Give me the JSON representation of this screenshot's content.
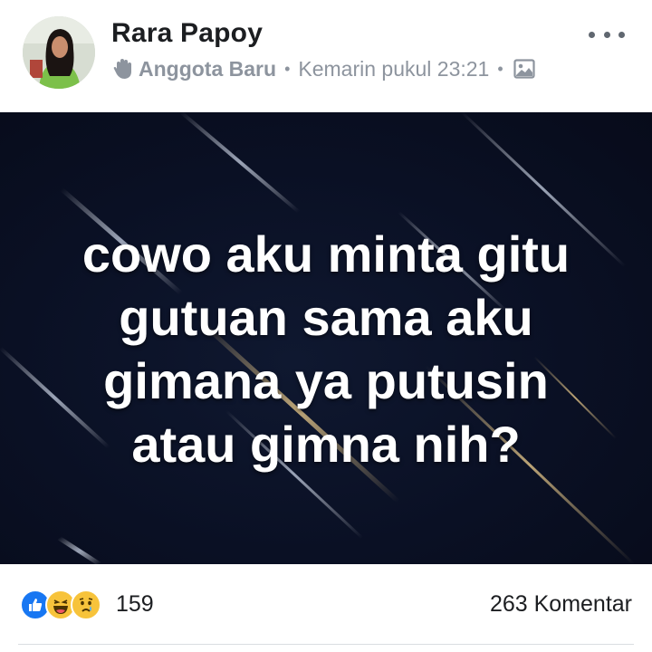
{
  "post": {
    "author_name": "Rara Papoy",
    "badge_label": "Anggota Baru",
    "timestamp": "Kemarin pukul 23:21",
    "separator": "•",
    "icons": {
      "badge": "wave-hand-icon",
      "audience": "photo-icon",
      "menu": "more-horizontal-icon"
    },
    "image_text_lines": [
      "cowo aku minta gitu",
      "gutuan sama aku",
      "gimana ya putusin",
      "atau gimna nih?"
    ],
    "image_background_color": "#0a1024"
  },
  "reactions": {
    "icons": [
      "like-icon",
      "haha-icon",
      "sad-icon"
    ],
    "count": "159",
    "comments": "263 Komentar",
    "colors": {
      "like": "#1877f2",
      "emoji": "#f7c33b"
    }
  }
}
